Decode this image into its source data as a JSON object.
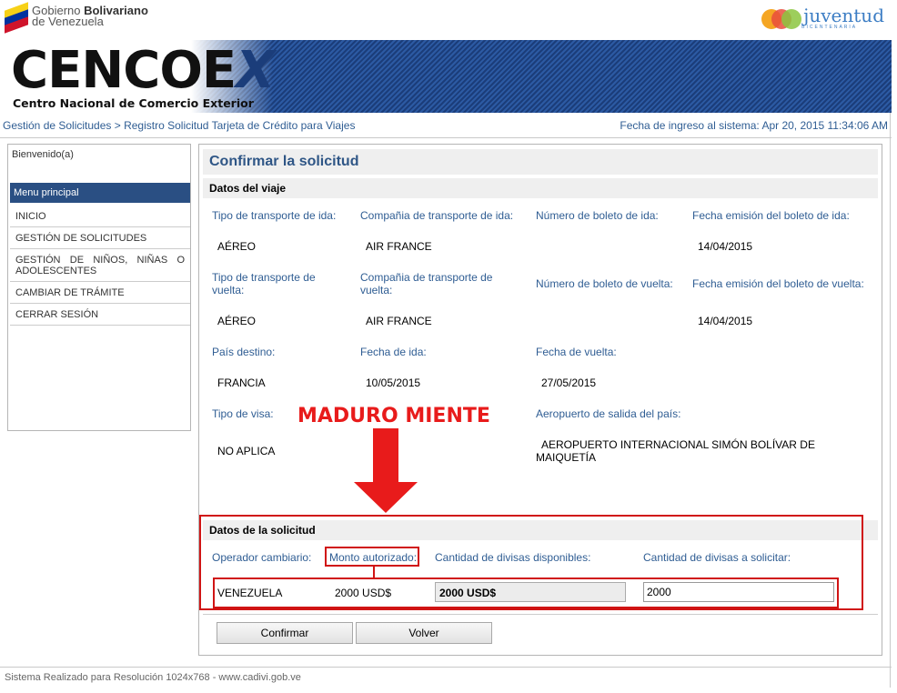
{
  "header": {
    "gov_line1_light": "Gobierno ",
    "gov_line1_bold": "Bolivariano",
    "gov_line2": "de Venezuela",
    "juventud_word": "juventud",
    "juventud_sub": "BICENTENARIA",
    "brand_main": "CENCOE",
    "brand_x": "X",
    "brand_sub": "Centro Nacional de Comercio Exterior"
  },
  "breadcrumb": "Gestión de Solicitudes > Registro Solicitud Tarjeta de Crédito para Viajes",
  "login_date": "Fecha de ingreso al sistema: Apr 20, 2015 11:34:06 AM",
  "sidebar": {
    "welcome": "Bienvenido(a)",
    "menu_title": "Menu principal",
    "items": [
      {
        "label": "INICIO"
      },
      {
        "label": "GESTIÓN DE SOLICITUDES"
      },
      {
        "label": "GESTIÓN DE NIÑOS, NIÑAS O ADOLESCENTES"
      },
      {
        "label": "CAMBIAR DE TRÁMITE"
      },
      {
        "label": "CERRAR SESIÓN"
      }
    ]
  },
  "form": {
    "title": "Confirmar la solicitud",
    "trip_section": "Datos del viaje",
    "trip": {
      "transport_out_label": "Tipo de transporte de ida:",
      "company_out_label": "Compañia de transporte de ida:",
      "ticket_out_label": "Número de boleto de ida:",
      "issue_out_label": "Fecha emisión del boleto de ida:",
      "transport_out": "AÉREO",
      "company_out": "AIR FRANCE",
      "issue_out": "14/04/2015",
      "transport_back_label": "Tipo de transporte de vuelta:",
      "company_back_label": "Compañia de transporte de vuelta:",
      "ticket_back_label": "Número de boleto de vuelta:",
      "issue_back_label": "Fecha emisión del boleto de vuelta:",
      "transport_back": "AÉREO",
      "company_back": "AIR FRANCE",
      "issue_back": "14/04/2015",
      "country_label": "País destino:",
      "depart_label": "Fecha de ida:",
      "return_label": "Fecha de vuelta:",
      "country": "FRANCIA",
      "depart": "10/05/2015",
      "return": "27/05/2015",
      "visa_label": "Tipo de visa:",
      "airport_label": "Aeropuerto de salida del país:",
      "visa": "NO APLICA",
      "airport": "AEROPUERTO INTERNACIONAL SIMÓN BOLÍVAR DE MAIQUETÍA"
    },
    "request_section": "Datos de la solicitud",
    "request": {
      "operator_label": "Operador cambiario:",
      "authorized_label": "Monto autorizado:",
      "available_label": "Cantidad de divisas disponibles:",
      "to_request_label": "Cantidad de divisas a solicitar:",
      "operator": "VENEZUELA",
      "authorized": "2000 USD$",
      "available": "2000 USD$",
      "to_request": "2000"
    },
    "confirm_label": "Confirmar",
    "back_label": "Volver"
  },
  "annotation": {
    "text": "MADURO MIENTE",
    "color": "#e81b1b"
  },
  "footer": "Sistema Realizado para Resolución 1024x768 - www.cadivi.gob.ve"
}
